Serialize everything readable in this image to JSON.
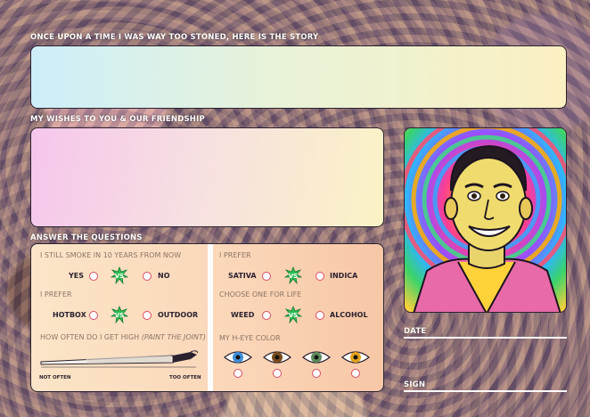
{
  "sections": {
    "story_label": "ONCE UPON A TIME I WAS WAY TOO STONED, HERE IS THE STORY",
    "wishes_label": "MY WISHES TO YOU & OUR FRIENDSHIP",
    "questions_label": "ANSWER THE QUESTIONS"
  },
  "questions": {
    "q1": {
      "title": "I STILL SMOKE IN 10 YEARS FROM NOW",
      "option_a": "YES",
      "option_b": "NO"
    },
    "q2": {
      "title": "I PREFER",
      "option_a": "HOTBOX",
      "option_b": "OUTDOOR"
    },
    "q3": {
      "title_prefix": "HOW OFTEN DO I GET HIGH ",
      "title_em": "(PAINT THE JOINT)",
      "scale_min": "NOT OFTEN",
      "scale_max": "TOO OFTEN"
    },
    "q4": {
      "title": "I PREFER",
      "option_a": "SATIVA",
      "option_b": "INDICA"
    },
    "q5": {
      "title": "CHOOSE ONE FOR LIFE",
      "option_a": "WEED",
      "option_b": "ALCOHOL"
    },
    "q6": {
      "title": "MY H-EYE COLOR",
      "eyes": [
        "blue-eye-icon",
        "brown-eye-icon",
        "green-eye-icon",
        "amber-eye-icon"
      ]
    }
  },
  "vs_text": "VS",
  "fields": {
    "date_label": "DATE",
    "sign_label": "SIGN"
  },
  "colors": {
    "radio": "#d84b64",
    "vs_leaf": "#2fbf52",
    "eye_blue": "#3d8ed8",
    "eye_brown": "#7a4a1c",
    "eye_green": "#5c8a5a",
    "eye_amber": "#e3a21a"
  }
}
